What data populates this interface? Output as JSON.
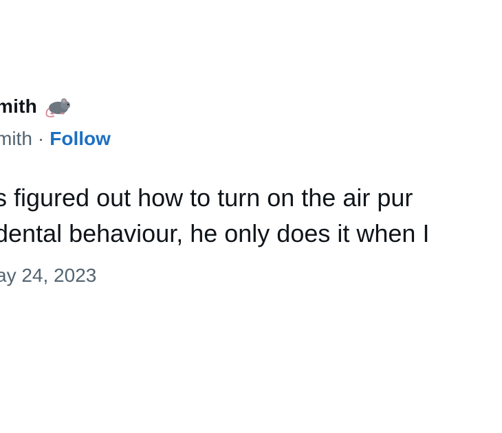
{
  "tweet": {
    "display_name": "mith",
    "handle": "mith",
    "separator": "·",
    "follow_label": "Follow",
    "text_lines": [
      "s figured out how to turn on the air pur",
      "dental behaviour, he only does it when I"
    ],
    "timestamp": "ay 24, 2023",
    "badge_icon": "rat-icon",
    "colors": {
      "follow": "#1d6fc2",
      "secondary_text": "#536471",
      "primary_text": "#0f1419"
    }
  }
}
